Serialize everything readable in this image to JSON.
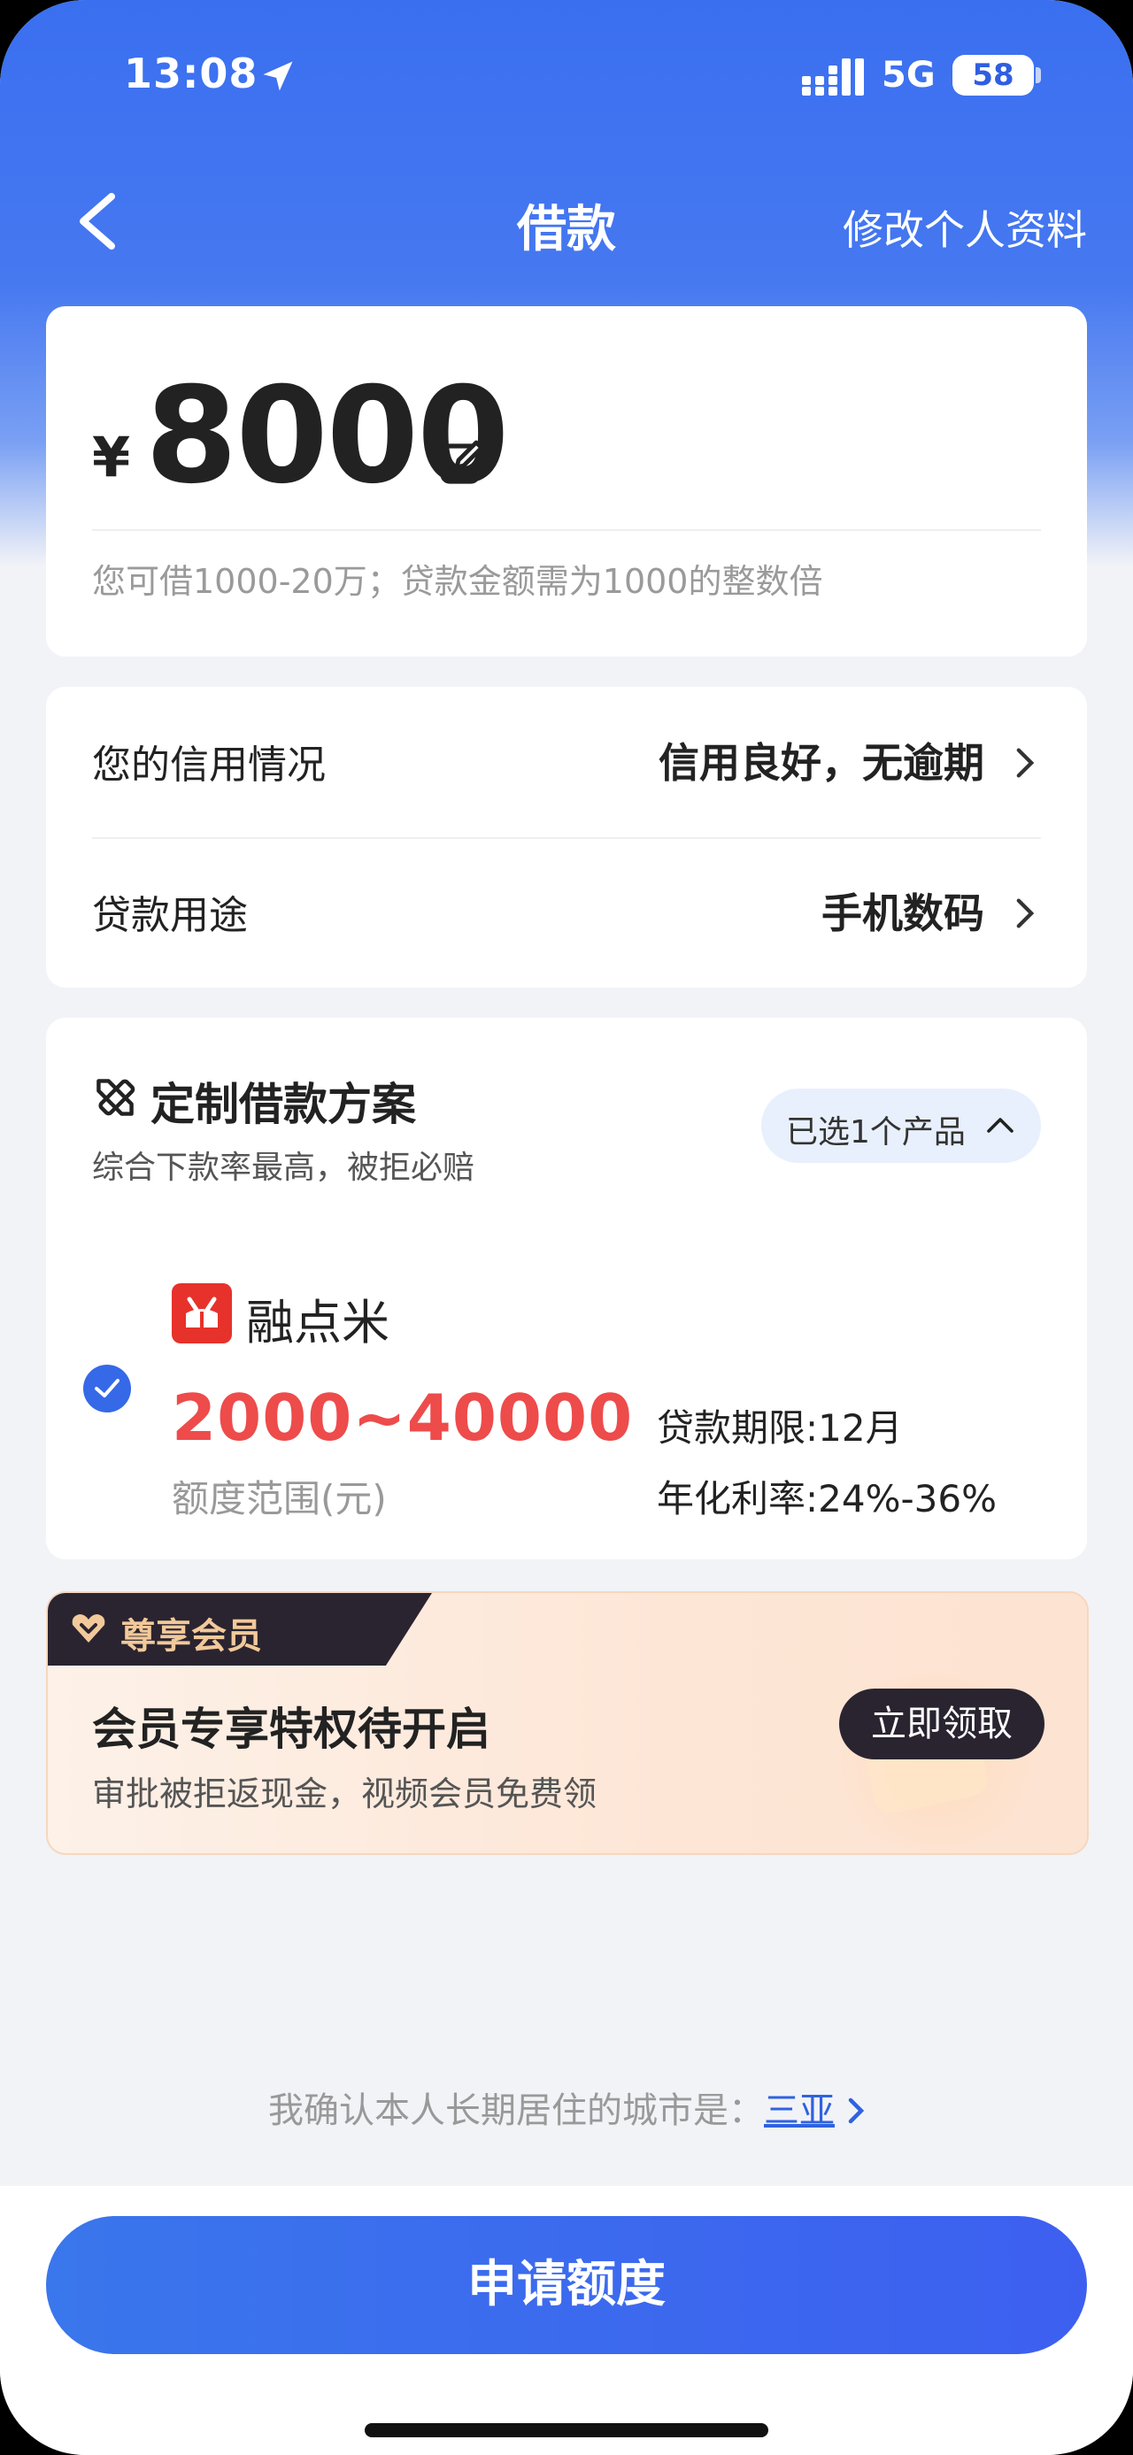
{
  "status_bar": {
    "time": "13:08",
    "network": "5G",
    "battery": "58"
  },
  "nav": {
    "title": "借款",
    "edit_profile": "修改个人资料"
  },
  "amount_card": {
    "currency": "¥",
    "amount": "8000",
    "hint": "您可借1000-20万；贷款金额需为1000的整数倍"
  },
  "info": {
    "credit_label": "您的信用情况",
    "credit_value": "信用良好，无逾期",
    "purpose_label": "贷款用途",
    "purpose_value": "手机数码"
  },
  "plan": {
    "title": "定制借款方案",
    "subtitle": "综合下款率最高，被拒必赔",
    "chip": "已选1个产品",
    "product": {
      "name": "融点米",
      "range": "2000~40000",
      "range_label": "额度范围(元)",
      "term": "贷款期限:12月",
      "rate": "年化利率:24%-36%",
      "checked": true,
      "logo_color": "#e6322b"
    }
  },
  "member": {
    "tag": "尊享会员",
    "title": "会员专享特权待开启",
    "subtitle": "审批被拒返现金，视频会员免费领",
    "button": "立即领取"
  },
  "city": {
    "prefix": "我确认本人长期居住的城市是：",
    "name": "三亚"
  },
  "apply_button": "申请额度",
  "colors": {
    "primary": "#3569e8",
    "accent_red": "#ee4b4b",
    "dark": "#2a2430"
  }
}
